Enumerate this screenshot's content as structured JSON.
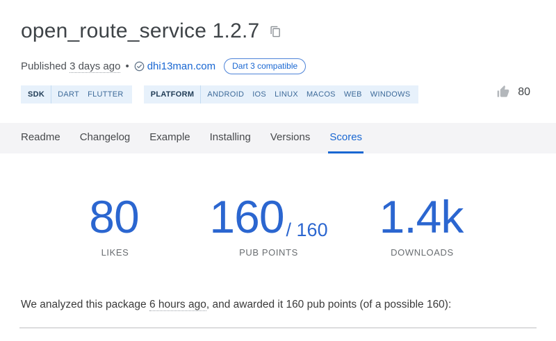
{
  "header": {
    "title": "open_route_service 1.2.7",
    "published_prefix": "Published ",
    "published_time": "3 days ago",
    "separator": "•",
    "publisher": "dhi13man.com",
    "badge": "Dart 3 compatible",
    "likes_count": "80"
  },
  "chips": [
    {
      "label": "SDK",
      "items": [
        "DART",
        "FLUTTER"
      ]
    },
    {
      "label": "PLATFORM",
      "items": [
        "ANDROID",
        "IOS",
        "LINUX",
        "MACOS",
        "WEB",
        "WINDOWS"
      ]
    }
  ],
  "tabs": [
    {
      "label": "Readme",
      "active": false
    },
    {
      "label": "Changelog",
      "active": false
    },
    {
      "label": "Example",
      "active": false
    },
    {
      "label": "Installing",
      "active": false
    },
    {
      "label": "Versions",
      "active": false
    },
    {
      "label": "Scores",
      "active": true
    }
  ],
  "scores": [
    {
      "value": "80",
      "suffix": "",
      "label": "LIKES"
    },
    {
      "value": "160",
      "suffix": "/ 160",
      "label": "PUB POINTS"
    },
    {
      "value": "1.4k",
      "suffix": "",
      "label": "DOWNLOADS"
    }
  ],
  "analysis": {
    "text_before": "We analyzed this package ",
    "time": "6 hours ago",
    "text_after": ", and awarded it 160 pub points (of a possible 160):"
  },
  "icons": {
    "copy": "copy-icon",
    "verified": "verified-publisher-icon",
    "thumb": "thumb-up-icon"
  },
  "colors": {
    "accent_blue": "#1967d2",
    "score_blue": "#2b66d0",
    "chip_background": "#e7f1fb",
    "tabbar_background": "#f4f4f6",
    "title_gray": "#3e4347"
  }
}
